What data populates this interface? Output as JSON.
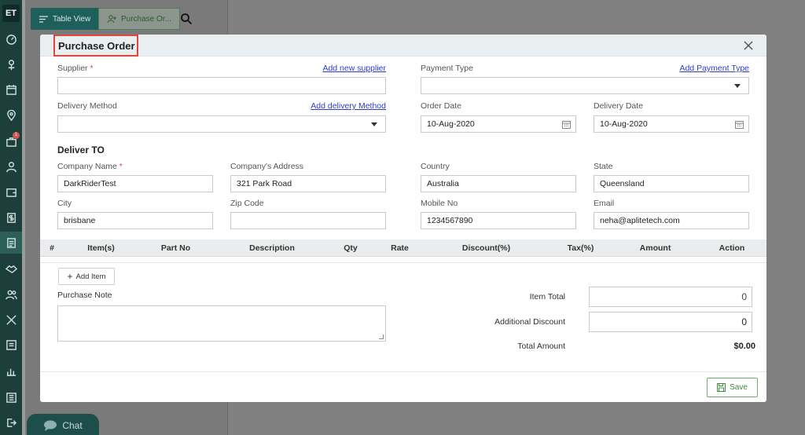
{
  "sidebar": {
    "logo": "ET",
    "badge_count": "1",
    "icons": [
      "dashboard-icon",
      "pin-icon",
      "calendar-icon",
      "location-icon",
      "briefcase-icon",
      "user-icon",
      "wallet-icon",
      "dollar-icon",
      "document-icon",
      "handshake-icon",
      "users-icon",
      "tools-icon",
      "list-icon",
      "chart-icon",
      "report-icon",
      "logout-icon"
    ]
  },
  "topbar": {
    "table_view_label": "Table View",
    "purchase_order_label": "Purchase Or..."
  },
  "chat_label": "Chat",
  "modal": {
    "title": "Purchase Order",
    "supplier": {
      "label": "Supplier",
      "required": "*",
      "link": "Add new supplier",
      "value": ""
    },
    "payment_type": {
      "label": "Payment Type",
      "link": "Add Payment Type",
      "value": ""
    },
    "delivery_method": {
      "label": "Delivery Method",
      "link": "Add delivery Method",
      "value": ""
    },
    "order_date": {
      "label": "Order Date",
      "value": "10-Aug-2020"
    },
    "delivery_date": {
      "label": "Delivery Date",
      "value": "10-Aug-2020"
    },
    "deliver_to_heading": "Deliver TO",
    "company_name": {
      "label": "Company Name",
      "required": "*",
      "value": "DarkRiderTest"
    },
    "company_address": {
      "label": "Company's Address",
      "value": "321 Park Road"
    },
    "country": {
      "label": "Country",
      "value": "Australia"
    },
    "state": {
      "label": "State",
      "value": "Queensland"
    },
    "city": {
      "label": "City",
      "value": "brisbane"
    },
    "zip": {
      "label": "Zip Code",
      "value": ""
    },
    "mobile": {
      "label": "Mobile No",
      "value": "1234567890"
    },
    "email": {
      "label": "Email",
      "value": "neha@aplitetech.com"
    },
    "table_headers": [
      "#",
      "Item(s)",
      "Part No",
      "Description",
      "Qty",
      "Rate",
      "Discount(%)",
      "Tax(%)",
      "Amount",
      "Action"
    ],
    "add_item_label": "Add Item",
    "purchase_note_label": "Purchase Note",
    "item_total": {
      "label": "Item Total",
      "value": "0"
    },
    "additional_discount": {
      "label": "Additional Discount",
      "value": "0"
    },
    "total_amount": {
      "label": "Total Amount",
      "value": "$0.00"
    },
    "save_label": "Save"
  },
  "colors": {
    "sidebar": "#1d3f3b",
    "accent_red": "#e0463a",
    "link": "#2c3ec8",
    "save_green": "#3c8d3e"
  }
}
